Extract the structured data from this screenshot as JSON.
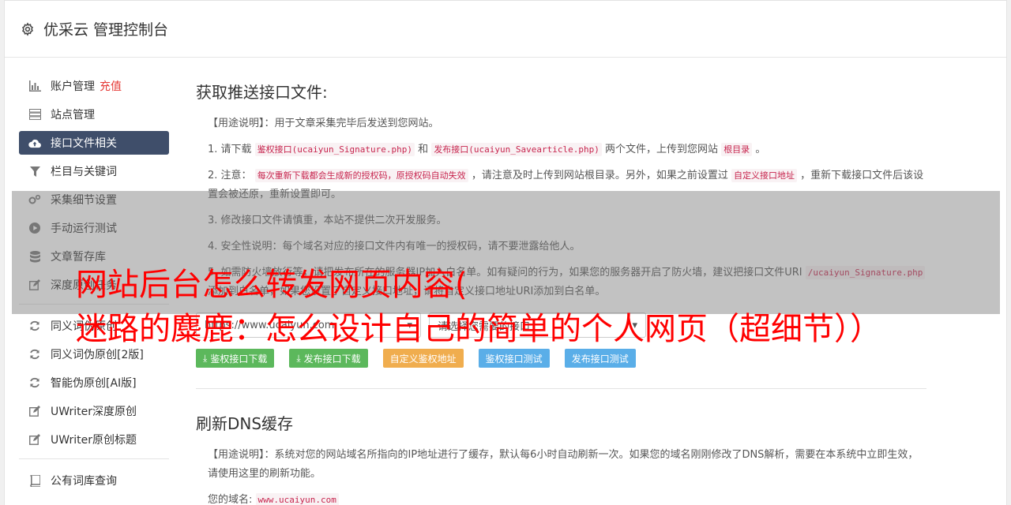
{
  "header": {
    "title": "优采云 管理控制台",
    "icon": "gear-icon"
  },
  "sidebar": {
    "items": [
      {
        "label": "账户管理",
        "extra": "充值",
        "icon": "bar-chart-icon"
      },
      {
        "label": "站点管理",
        "icon": "server-icon"
      },
      {
        "label": "接口文件相关",
        "icon": "cloud-upload-icon",
        "active": true
      },
      {
        "label": "栏目与关键词",
        "icon": "filter-icon"
      },
      {
        "label": "采集细节设置",
        "icon": "cogs-icon"
      },
      {
        "label": "手动运行测试",
        "icon": "play-circle-icon"
      },
      {
        "label": "文章暂存库",
        "icon": "database-icon"
      },
      {
        "label": "深度原创任务",
        "icon": "edit-icon"
      },
      {
        "label": "同义词伪原创",
        "icon": "refresh-icon"
      },
      {
        "label": "同义词伪原创[2版]",
        "icon": "refresh-icon"
      },
      {
        "label": "智能伪原创[AI版]",
        "icon": "refresh-icon"
      },
      {
        "label": "UWriter深度原创",
        "icon": "edit-icon"
      },
      {
        "label": "UWriter原创标题",
        "icon": "edit-icon"
      },
      {
        "label": "公有词库查询",
        "icon": "book-icon"
      }
    ]
  },
  "section1": {
    "title": "获取推送接口文件:",
    "usage": "【用途说明】：用于文章采集完毕后发送到您网站。",
    "p1_pre": "1. 请下载",
    "p1_code1": "鉴权接口(ucaiyun_Signature.php)",
    "p1_mid": "和",
    "p1_code2": "发布接口(ucaiyun_Savearticle.php)",
    "p1_post": "两个文件，上传到您网站",
    "p1_code3": "根目录",
    "p1_end": "。",
    "p2_pre": "2. 注意：",
    "p2_code1": "每次重新下载都会生成新的授权码，原授权码自动失效",
    "p2_mid": "，请注意及时上传到网站根目录。另外，如果之前设置过",
    "p2_code2": "自定义接口地址",
    "p2_post": "，重新下载接口文件后该设置会被还原，重新设置即可。",
    "p3": "3. 修改接口文件请慎重，本站不提供二次开发服务。",
    "p4": "4. 安全性说明：每个域名对应的接口文件内有唯一的授权码，请不要泄露给他人。",
    "p5_pre": "5. 如需防火墙放行等，请把发布所在的服务器IP加入白名单。如有疑问的行为，如果您的服务器开启了防火墙，建议把接口文件URI",
    "p5_code": "/ucaiyun_Signature.php",
    "p5_post": "添加到白名单，如果您设置了自定义接口地址，请将自定义接口地址URI添加到白名单。",
    "select_site": "https://www.ucaiyun.com",
    "select_placeholder": "请选择您需要的接口",
    "buttons": {
      "auth_download": "鉴权接口下载",
      "publish_download": "发布接口下载",
      "custom_auth": "自定义鉴权地址",
      "auth_test": "鉴权接口测试",
      "publish_test": "发布接口测试"
    }
  },
  "section2": {
    "title": "刷新DNS缓存",
    "usage": "【用途说明】：系统对您的网站域名所指向的IP地址进行了缓存，默认每6小时自动刷新一次。如果您的域名刚刚修改了DNS解析，需要在本系统中立即生效，请使用这里的刷新功能。",
    "domain_label": "您的域名:",
    "domain_value": "www.ucaiyun.com"
  },
  "overlay": {
    "line1": "网站后台怎么转发网页内容(",
    "line2": "迷路的麋鹿：怎么设计自己的简单的个人网页（超细节））"
  },
  "colors": {
    "accent": "#3f4e6a",
    "red": "#ff0000",
    "green": "#5cb85c",
    "orange": "#f0ad4e",
    "blue": "#5aaee8"
  }
}
